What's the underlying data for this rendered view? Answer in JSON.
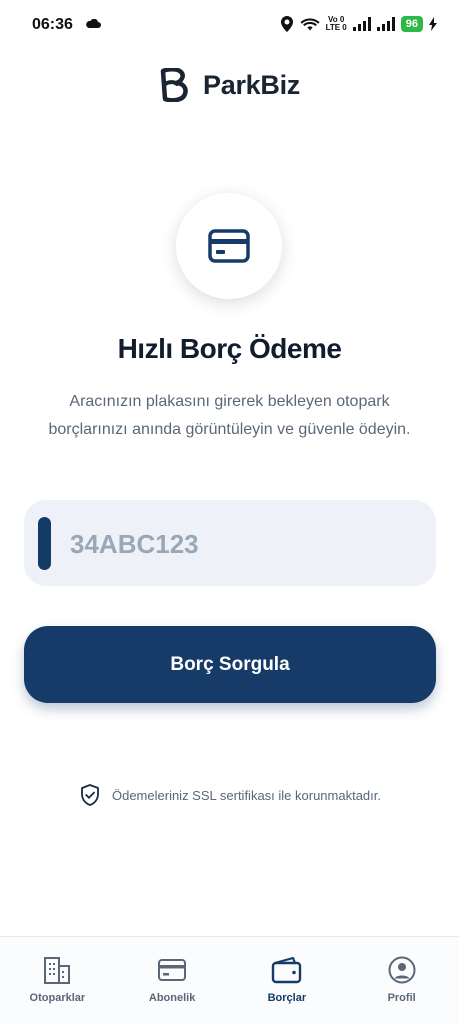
{
  "status_bar": {
    "time": "06:36",
    "battery": "96",
    "volte_top": "Vo 0",
    "volte_bottom": "LTE 0"
  },
  "brand": {
    "logo_letter": "B",
    "name": "ParkBiz"
  },
  "hero": {
    "icon": "credit-card-icon"
  },
  "page": {
    "title": "Hızlı Borç Ödeme",
    "description": "Aracınızın plakasını girerek bekleyen otopark borçlarınızı anında görüntüleyin ve güvenle ödeyin."
  },
  "plate_input": {
    "placeholder": "34ABC123",
    "value": ""
  },
  "query_button": {
    "label": "Borç Sorgula"
  },
  "ssl_note": {
    "text": "Ödemeleriniz SSL sertifikası ile korunmaktadır.",
    "icon": "shield-check-icon"
  },
  "bottom_nav": {
    "items": [
      {
        "label": "Otoparklar",
        "icon": "building-icon",
        "active": false
      },
      {
        "label": "Abonelik",
        "icon": "card-icon",
        "active": false
      },
      {
        "label": "Borçlar",
        "icon": "wallet-icon",
        "active": true
      },
      {
        "label": "Profil",
        "icon": "user-circle-icon",
        "active": false
      }
    ]
  },
  "colors": {
    "primary": "#163b68",
    "input_bg": "#eef2f8",
    "battery": "#2fb84a"
  }
}
